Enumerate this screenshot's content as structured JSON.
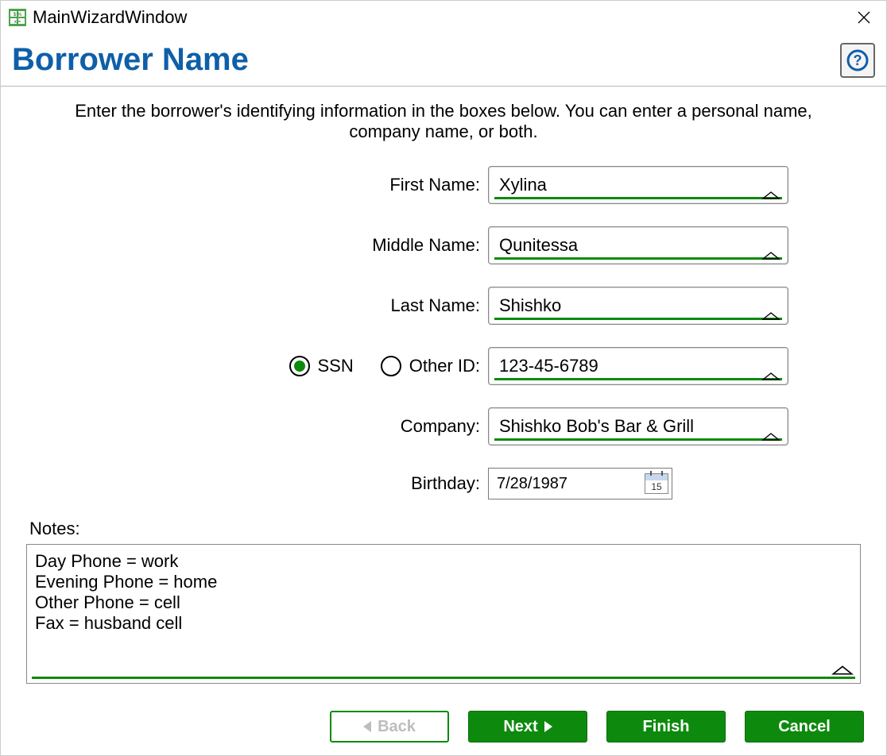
{
  "window": {
    "title": "MainWizardWindow"
  },
  "header": {
    "title": "Borrower Name"
  },
  "instructions": "Enter the borrower's identifying information in the boxes below. You can enter a personal name, company name, or both.",
  "labels": {
    "first_name": "First Name:",
    "middle_name": "Middle Name:",
    "last_name": "Last Name:",
    "ssn": "SSN",
    "other_id": "Other ID:",
    "company": "Company:",
    "birthday": "Birthday:",
    "notes": "Notes:"
  },
  "form": {
    "first_name": "Xylina",
    "middle_name": "Qunitessa",
    "last_name": "Shishko",
    "id_type_selected": "ssn",
    "id_value": "123-45-6789",
    "company": "Shishko Bob's Bar & Grill",
    "birthday": "7/28/1987",
    "calendar_day_display": "15",
    "notes": "Day Phone = work\nEvening Phone = home\nOther Phone = cell\nFax = husband cell"
  },
  "footer": {
    "back": "Back",
    "next": "Next",
    "finish": "Finish",
    "cancel": "Cancel"
  }
}
